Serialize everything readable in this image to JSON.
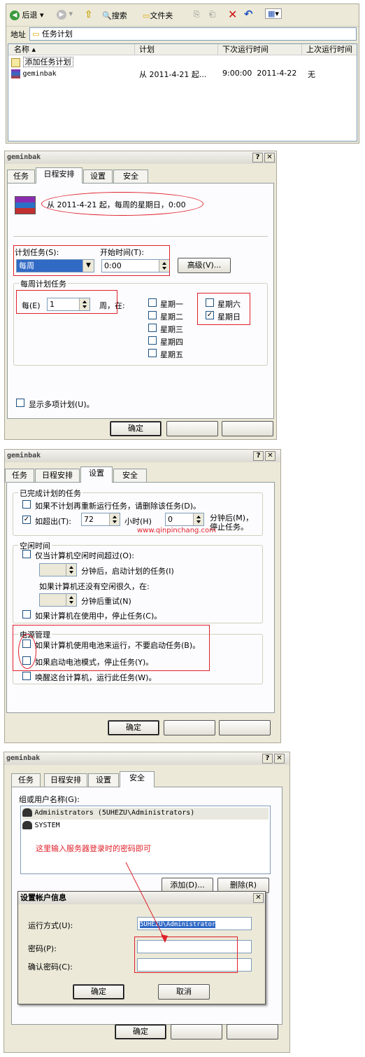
{
  "explorer": {
    "back_label": "后退",
    "search_label": "搜索",
    "folders_label": "文件夹",
    "address_label": "地址",
    "address_value": "任务计划",
    "columns": [
      "名称",
      "计划",
      "下次运行时间",
      "上次运行时间"
    ],
    "rows": [
      {
        "name": "添加任务计划",
        "schedule": "",
        "next": "",
        "last": ""
      },
      {
        "name": "geminbak",
        "schedule": "从 2011-4-21 起...",
        "next": "9:00:00  2011-4-22",
        "last": "无"
      }
    ]
  },
  "d1": {
    "title": "geminbak",
    "tabs": [
      "任务",
      "日程安排",
      "设置",
      "安全"
    ],
    "summary": "从 2011-4-21 起，每周的星期日，0:00",
    "schedule_label": "计划任务(S):",
    "schedule_value": "每周",
    "start_label": "开始时间(T):",
    "start_value": "0:00",
    "advanced_label": "高级(V)...",
    "weekly_group": "每周计划任务",
    "every_label": "每(E)",
    "every_value": "1",
    "week_on_label": "周，在:",
    "days": [
      "星期一",
      "星期二",
      "星期三",
      "星期四",
      "星期五",
      "星期六",
      "星期日"
    ],
    "multi_label": "显示多项计划(U)。",
    "ok_label": "确定"
  },
  "d2": {
    "title": "geminbak",
    "tabs": [
      "任务",
      "日程安排",
      "设置",
      "安全"
    ],
    "done_group": "已完成计划的任务",
    "delete_label": "如果不计划再重新运行任务，请删除该任务(D)。",
    "stop_after_label": "如超出(T):",
    "stop_hours": "72",
    "hours_label": "小时(H)",
    "stop_minutes": "0",
    "minutes_after": "分钟后(M)，",
    "stop_task": "停止任务。",
    "watermark": "www.qinpinchang.com",
    "idle_group": "空闲时间",
    "idle_only": "仅当计算机空闲时间超过(O):",
    "idle_then": "分钟后，启动计划的任务(I)",
    "idle_notlong": "如果计算机还没有空闲很久，在:",
    "idle_retry": "分钟后重试(N)",
    "idle_stop": "如果计算机在使用中，停止任务(C)。",
    "power_group": "电源管理",
    "power_battery": "如果计算机使用电池来运行，不要启动任务(B)。",
    "power_stop": "如果启动电池模式，停止任务(Y)。",
    "power_wake": "唤醒这台计算机，运行此任务(W)。",
    "ok_label": "确定"
  },
  "d3": {
    "title": "geminbak",
    "tabs": [
      "任务",
      "日程安排",
      "设置",
      "安全"
    ],
    "users_label": "组或用户名称(G):",
    "users": [
      "Administrators (5UHEZU\\Administrators)",
      "SYSTEM"
    ],
    "note": "这里输入服务器登录时的密码即可",
    "add_label": "添加(D)...",
    "remove_label": "删除(R)",
    "ok_label": "确定",
    "sub": {
      "title": "设置帐户信息",
      "runas_label": "运行方式(U):",
      "runas_value": "5UHEZU\\Administrator",
      "pw_label": "密码(P):",
      "confirm_label": "确认密码(C):",
      "ok_label": "确定",
      "cancel_label": "取消"
    }
  }
}
